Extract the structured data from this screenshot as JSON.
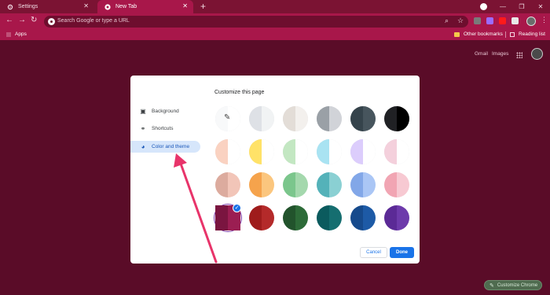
{
  "tabs": [
    {
      "label": "Settings",
      "icon": "gear-icon"
    },
    {
      "label": "New Tab",
      "icon": "chrome-icon"
    }
  ],
  "toolbar": {
    "omnibox_placeholder": "Search Google or type a URL"
  },
  "bookmarks": {
    "apps_label": "Apps",
    "other_bookmarks_label": "Other bookmarks",
    "reading_list_label": "Reading list"
  },
  "page": {
    "gmail_label": "Gmail",
    "images_label": "Images",
    "customize_chrome_label": "Customize Chrome"
  },
  "dialog": {
    "title": "Customize this page",
    "sidebar": [
      {
        "label": "Background",
        "icon": "image-icon",
        "selected": false
      },
      {
        "label": "Shortcuts",
        "icon": "link-icon",
        "selected": false
      },
      {
        "label": "Color and theme",
        "icon": "palette-icon",
        "selected": true
      }
    ],
    "cancel_label": "Cancel",
    "done_label": "Done",
    "themes": [
      [
        "#f8f9fa",
        "#ffffff"
      ],
      [
        "#dee1e6",
        "#f1f3f4"
      ],
      [
        "#e3ddd7",
        "#f3f0ed"
      ],
      [
        "#9aa0a6",
        "#d1d3d8"
      ],
      [
        "#35434b",
        "#47555d"
      ],
      [
        "#202124",
        "#000000"
      ],
      [
        "#fad2c1",
        "#ffffff"
      ],
      [
        "#ffe268",
        "#ffffff"
      ],
      [
        "#c3e7c2",
        "#ffffff"
      ],
      [
        "#a9e3f2",
        "#ffffff"
      ],
      [
        "#dccdfc",
        "#ffffff"
      ],
      [
        "#f4d0dc",
        "#ffffff"
      ],
      [
        "#dcab9e",
        "#f2c5b8"
      ],
      [
        "#f5a34c",
        "#fbc67e"
      ],
      [
        "#7bc68c",
        "#a4d8ad"
      ],
      [
        "#54b2b9",
        "#8ad0d3"
      ],
      [
        "#82a7e8",
        "#aac6f5"
      ],
      [
        "#f1a5b3",
        "#f7c9d2"
      ],
      [
        "#7a1540",
        "#9b1e52"
      ],
      [
        "#9f1c1c",
        "#b42a2a"
      ],
      [
        "#22532c",
        "#2d6b38"
      ],
      [
        "#0b5b5e",
        "#156e70"
      ],
      [
        "#164a8c",
        "#1d5aa6"
      ],
      [
        "#5b2a96",
        "#6d3aab"
      ]
    ],
    "selected_theme_index": 18,
    "custom_theme_index": 0
  },
  "colors": {
    "frame": "#7b1333",
    "toolbar": "#a8174a",
    "page_bg": "#5a0c28",
    "accent": "#1a73e8",
    "annotation_arrow": "#e8346a"
  }
}
